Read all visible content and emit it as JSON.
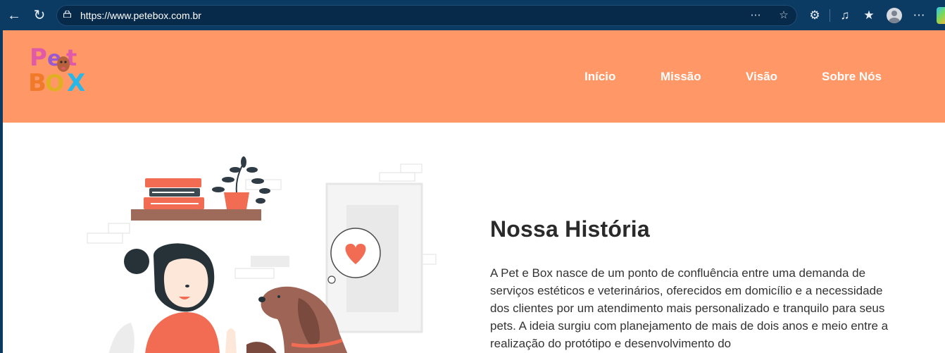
{
  "browser": {
    "url": "https://www.petebox.com.br",
    "icons": [
      "back-icon",
      "refresh-icon",
      "lock-icon",
      "more-tools-icon",
      "favorite-star-icon",
      "extensions-icon",
      "read-aloud-icon",
      "favorites-icon",
      "profile-icon",
      "more-menu-icon"
    ]
  },
  "header": {
    "logo_text": "Pet Box",
    "nav": [
      {
        "label": "Início"
      },
      {
        "label": "Missão"
      },
      {
        "label": "Visão"
      },
      {
        "label": "Sobre Nós"
      }
    ]
  },
  "about": {
    "title": "Nossa História",
    "body": "A Pet e Box nasce de um ponto de confluência entre uma demanda de serviços estéticos e veterinários, oferecidos em domicílio e a necessidade dos clientes por um atendimento mais personalizado e tranquilo para seus pets. A ideia surgiu com planejamento de mais de dois anos e meio entre a realização do protótipo e desenvolvimento do"
  },
  "colors": {
    "header_bg": "#ff9866",
    "browser_chrome": "#0b3a63",
    "accent": "#f26b53"
  }
}
